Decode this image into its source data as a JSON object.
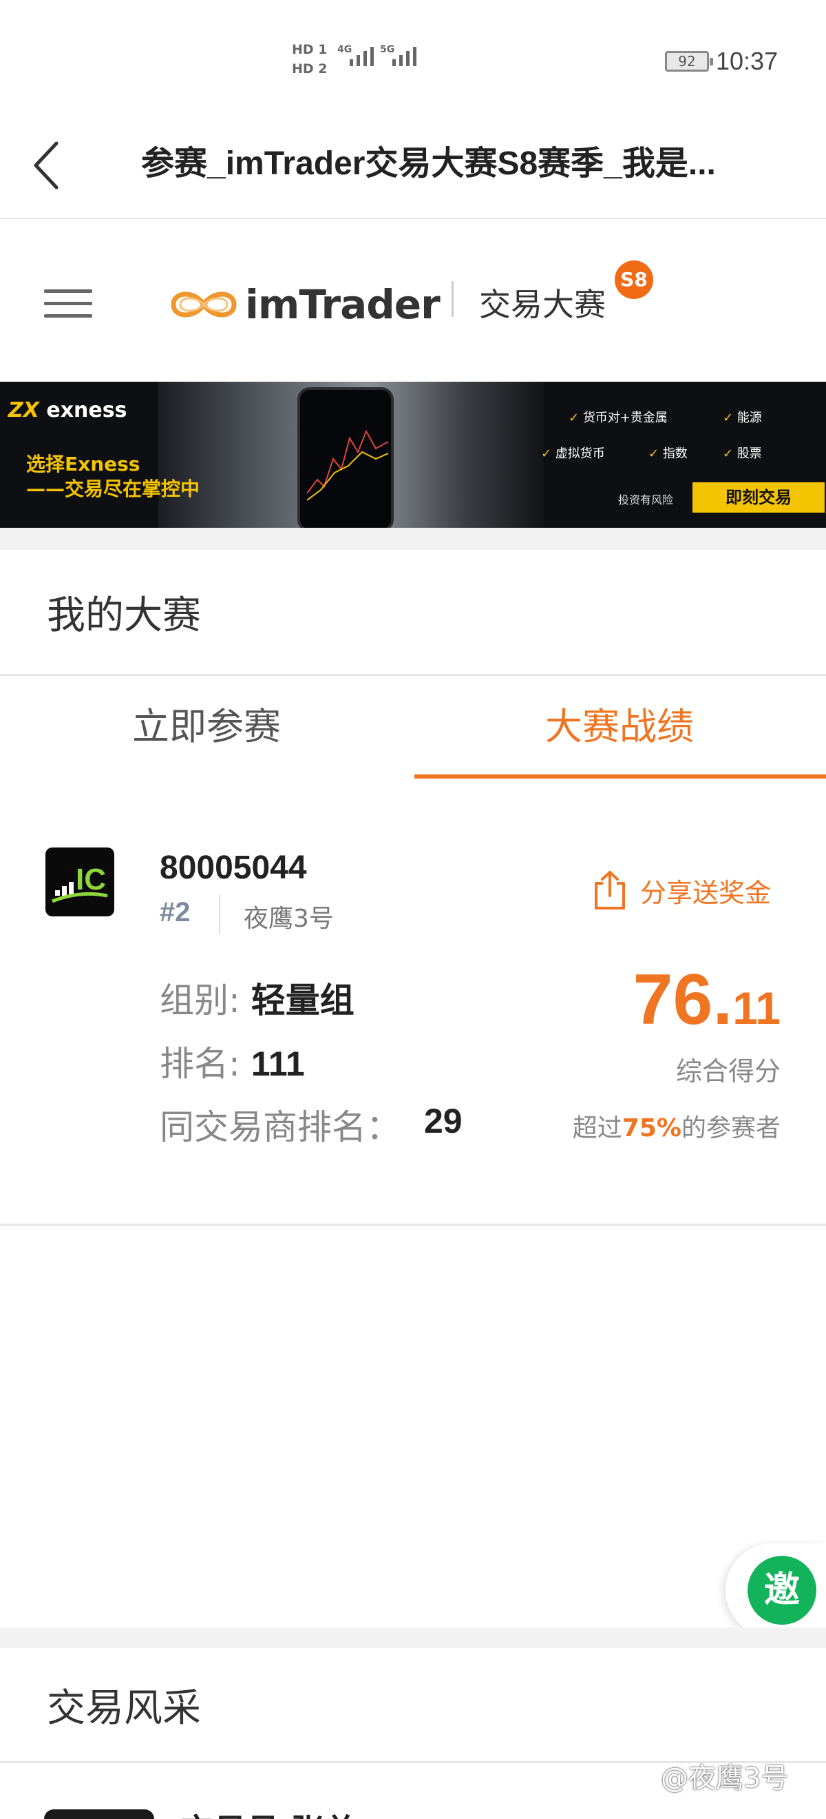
{
  "status_bar": {
    "hd1": "HD 1",
    "hd2": "HD 2",
    "net1": "4G",
    "net2": "5G",
    "battery": "92",
    "time": "10:37"
  },
  "nav": {
    "title": "参赛_imTrader交易大赛S8赛季_我是...",
    "back_icon": "chevron-left-icon"
  },
  "brand": {
    "logo_text": "imTrader",
    "subtitle": "交易大赛",
    "season_badge": "S8",
    "menu_icon": "hamburger-icon"
  },
  "banner": {
    "brand": "exness",
    "line1": "选择Exness",
    "line2": "——交易尽在掌控中",
    "features": [
      "货币对+贵金属",
      "能源",
      "虚拟货币",
      "指数",
      "股票"
    ],
    "risk": "投资有风险",
    "cta": "即刻交易"
  },
  "my_contest": {
    "title": "我的大赛",
    "tabs": [
      {
        "label": "立即参赛",
        "active": false
      },
      {
        "label": "大赛战绩",
        "active": true
      }
    ]
  },
  "record": {
    "account_id": "80005044",
    "rank_no": "#2",
    "nickname": "夜鹰3号",
    "share_label": "分享送奖金",
    "group_label": "组别:",
    "group_value": "轻量组",
    "rank_label": "排名:",
    "rank_value": "111",
    "broker_rank_label": "同交易商排名：",
    "broker_rank_value": "29",
    "score_int": "76.",
    "score_dec": "11",
    "score_label": "综合得分",
    "beat_prefix": "超过",
    "beat_percent": "75%",
    "beat_suffix": "的参赛者"
  },
  "invite": {
    "label": "邀"
  },
  "trade_showcase": {
    "title": "交易风采",
    "first_trader": "交易员 张总"
  },
  "watermark": "@夜鹰3号",
  "colors": {
    "accent": "#f07522",
    "badge": "#f26a15",
    "invite": "#12b35a",
    "banner_yellow": "#f5c400"
  }
}
